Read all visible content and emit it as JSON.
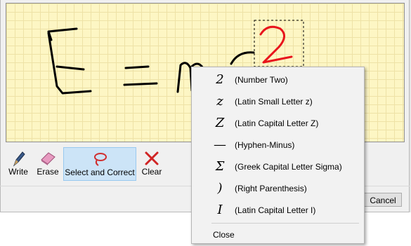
{
  "toolbar": {
    "write_label": "Write",
    "erase_label": "Erase",
    "select_correct_label": "Select and Correct",
    "clear_label": "Clear"
  },
  "footer": {
    "cancel_label": "Cancel"
  },
  "menu": {
    "items": [
      {
        "glyph": "2",
        "desc": "(Number Two)"
      },
      {
        "glyph": "z",
        "desc": "(Latin Small Letter z)"
      },
      {
        "glyph": "Z",
        "desc": "(Latin Capital Letter Z)"
      },
      {
        "glyph": "—",
        "desc": "(Hyphen-Minus)"
      },
      {
        "glyph": "Σ",
        "desc": "(Greek Capital Letter Sigma)"
      },
      {
        "glyph": ")",
        "desc": "(Right Parenthesis)"
      },
      {
        "glyph": "I",
        "desc": "(Latin Capital Letter I)"
      }
    ],
    "close_label": "Close"
  },
  "colors": {
    "ink": "#000000",
    "selected_ink": "#e8141c",
    "paper": "#fdf6c4",
    "selection_bg": "#cce4f7"
  }
}
